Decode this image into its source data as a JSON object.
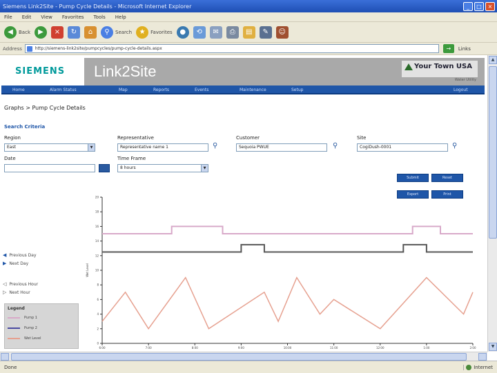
{
  "window": {
    "title": "Siemens Link2Site - Pump Cycle Details - Microsoft Internet Explorer",
    "buttons": {
      "minimize": "_",
      "maximize": "□",
      "close": "×"
    }
  },
  "menu": [
    "File",
    "Edit",
    "View",
    "Favorites",
    "Tools",
    "Help"
  ],
  "toolbar": {
    "back": "Back",
    "search": "Search",
    "favorites": "Favorites"
  },
  "address": {
    "label": "Address",
    "url": "http://siemens-link2site/pumpcycles/pump-cycle-details.aspx",
    "go": "→",
    "links": "Links"
  },
  "brand": {
    "logo": "SIEMENS",
    "app": "Link2Site",
    "town": "Your Town USA",
    "sub": "Water Utility"
  },
  "nav": [
    "Home",
    "Alarm Status",
    "Map",
    "Reports",
    "Events",
    "Maintenance",
    "Setup",
    "Logout"
  ],
  "breadcrumb": "Graphs > Pump Cycle Details",
  "section": "Search Criteria",
  "form": {
    "region_label": "Region",
    "region_value": "East",
    "representative_label": "Representative",
    "representative_value": "Representative name 1",
    "customer_label": "Customer",
    "customer_value": "Sequoia PWUE",
    "site_label": "Site",
    "site_value": "CogiDush-0001",
    "date_label": "Date",
    "date_value": "",
    "timeframe_label": "Time Frame",
    "timeframe_value": "8 hours"
  },
  "actions": {
    "b1": "Submit",
    "b2": "Reset",
    "b3": "Export",
    "b4": "Print"
  },
  "side": {
    "prev_day": "Previous Day",
    "next_day": "Next Day",
    "prev_hour": "Previous Hour",
    "next_hour": "Next Hour"
  },
  "legend": {
    "title": "Legend",
    "items": [
      {
        "label": "Pump 1",
        "color": "#d8a9c9"
      },
      {
        "label": "Pump 2",
        "color": "#4a4aa0"
      },
      {
        "label": "Wet Level",
        "color": "#e6a08f"
      }
    ]
  },
  "status": {
    "text": "Done",
    "zone": "Internet"
  },
  "chart_data": {
    "type": "line",
    "title": "",
    "xlabel": "",
    "ylabel": "Wet Level",
    "ylim": [
      0,
      20
    ],
    "yticks": [
      0,
      2,
      4,
      6,
      8,
      10,
      12,
      14,
      16,
      18,
      20
    ],
    "xticks": [
      "6:00",
      "7:00",
      "8:00",
      "9:00",
      "10:00",
      "11:00",
      "12:00",
      "1:00",
      "2:00"
    ],
    "xlim": [
      0,
      8
    ],
    "series": [
      {
        "name": "Pump 1",
        "color": "#d8a9c9",
        "x": [
          0,
          1.5,
          1.5,
          2.6,
          2.6,
          6.7,
          6.7,
          7.3,
          7.3,
          8
        ],
        "values": [
          15,
          15,
          16,
          16,
          15,
          15,
          16,
          16,
          15,
          15
        ]
      },
      {
        "name": "Pump 2",
        "color": "#555555",
        "x": [
          0,
          3.0,
          3.0,
          3.5,
          3.5,
          6.5,
          6.5,
          7.0,
          7.0,
          8
        ],
        "values": [
          12.5,
          12.5,
          13.5,
          13.5,
          12.5,
          12.5,
          13.5,
          13.5,
          12.5,
          12.5
        ]
      },
      {
        "name": "Wet Level",
        "color": "#e6a08f",
        "x": [
          0,
          0.5,
          1.0,
          1.8,
          2.3,
          3.5,
          3.8,
          4.2,
          4.7,
          5.0,
          6.0,
          7.0,
          7.8,
          8
        ],
        "values": [
          3,
          7,
          2,
          9,
          2,
          7,
          3,
          9,
          4,
          6,
          2,
          9,
          4,
          7
        ]
      }
    ],
    "grid": false
  }
}
